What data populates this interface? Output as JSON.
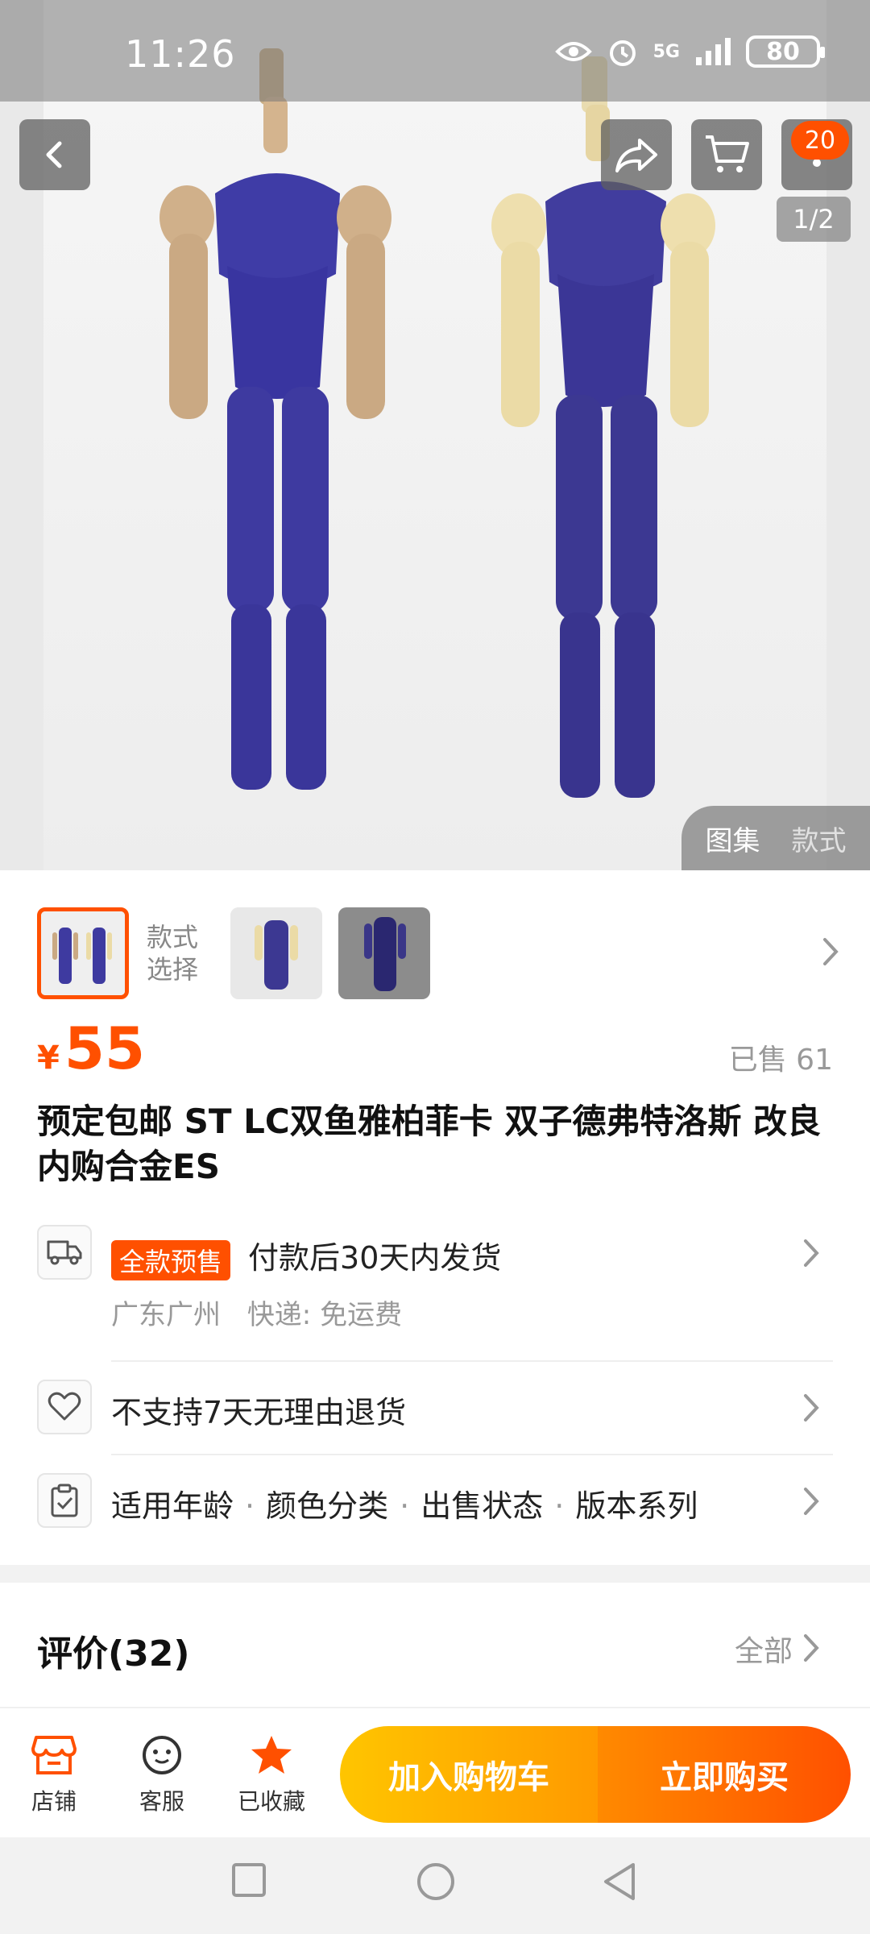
{
  "status_bar": {
    "time": "11:26",
    "network": "5G",
    "battery": "80"
  },
  "header": {
    "badge_count": "20",
    "page_indicator": "1/2"
  },
  "gallery_tabs": {
    "tab_gallery": "图集",
    "tab_style": "款式"
  },
  "style_selector": {
    "label": "款式\n选择"
  },
  "price": {
    "currency": "¥",
    "value": "55"
  },
  "sold": "已售 61",
  "title": "预定包邮 ST LC双鱼雅柏菲卡 双子德弗特洛斯 改良内购合金ES",
  "shipping": {
    "tag": "全款预售",
    "text": "付款后30天内发货",
    "origin": "广东广州",
    "method": "快递: 免运费"
  },
  "returns": {
    "text": "不支持7天无理由退货"
  },
  "params": {
    "items": [
      "适用年龄",
      "颜色分类",
      "出售状态",
      "版本系列"
    ]
  },
  "reviews": {
    "title": "评价(32)",
    "all_label": "全部"
  },
  "bottom_bar": {
    "store": "店铺",
    "service": "客服",
    "favorite": "已收藏",
    "add_to_cart": "加入购物车",
    "buy_now": "立即购买"
  },
  "colors": {
    "accent": "#ff5000",
    "cart_gradient": "#ffc500",
    "figure_blue": "#3d3a9c"
  }
}
